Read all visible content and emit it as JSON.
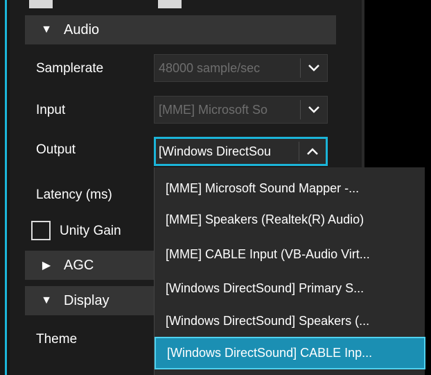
{
  "sections": {
    "audio": {
      "title": "Audio",
      "arrow_icon": "triangle-down-icon"
    },
    "agc": {
      "title": "AGC",
      "arrow_icon": "triangle-right-icon"
    },
    "display": {
      "title": "Display",
      "arrow_icon": "triangle-down-icon"
    }
  },
  "audio": {
    "samplerate_label": "Samplerate",
    "samplerate_value": "48000 sample/sec",
    "input_label": "Input",
    "input_value": "[MME] Microsoft So",
    "output_label": "Output",
    "output_value": "[Windows DirectSou",
    "latency_label": "Latency (ms)",
    "unity_gain_label": "Unity Gain"
  },
  "display": {
    "theme_label": "Theme"
  },
  "output_dropdown": {
    "options": [
      "[MME] Microsoft Sound Mapper -...",
      "[MME] Speakers (Realtek(R) Audio)",
      "[MME] CABLE Input (VB-Audio Virt...",
      "[Windows DirectSound] Primary S...",
      "[Windows DirectSound] Speakers (...",
      "[Windows DirectSound] CABLE Inp..."
    ],
    "selected_index": 5
  },
  "colors": {
    "accent": "#1bb4d8",
    "selected_bg": "#1b8fb3",
    "panel_bg": "#1c1c1c",
    "header_bg": "#353535"
  }
}
